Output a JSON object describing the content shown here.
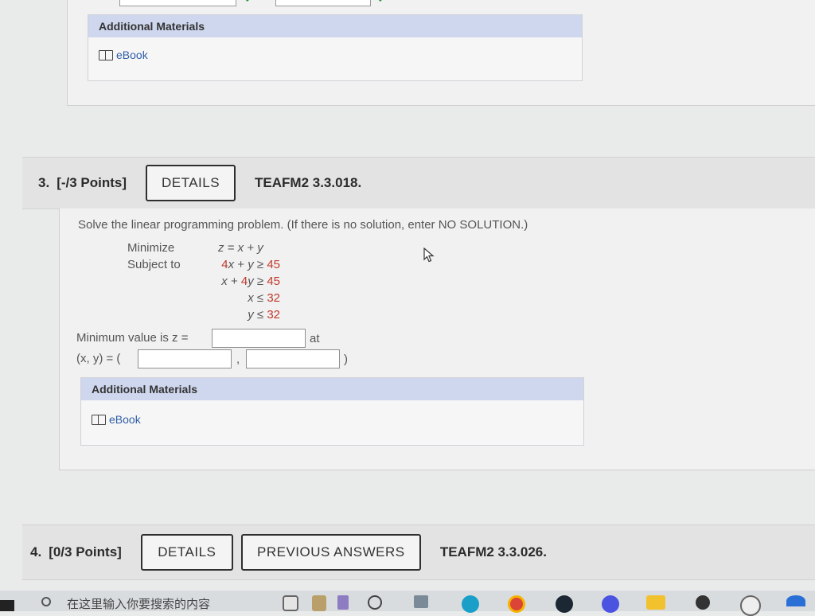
{
  "q2": {
    "additional_materials": "Additional Materials",
    "ebook": "eBook"
  },
  "q3": {
    "number": "3.",
    "points": "[-/3 Points]",
    "details_label": "DETAILS",
    "code": "TEAFM2 3.3.018.",
    "instructions": "Solve the linear programming problem. (If there is no solution, enter NO SOLUTION.)",
    "minimize_label": "Minimize",
    "objective": "z = x + y",
    "subject_to_label": "Subject to",
    "constraints": [
      "4x + y ≥ 45",
      "x + 4y ≥ 45",
      "x ≤ 32",
      "y ≤ 32"
    ],
    "min_value_label": "Minimum value is z =",
    "at_label": "at",
    "xy_label": "(x, y) = (",
    "comma": ",",
    "close_paren": ")",
    "min_value": "",
    "x_value": "",
    "y_value": "",
    "additional_materials": "Additional Materials",
    "ebook": "eBook"
  },
  "q4": {
    "number": "4.",
    "points": "[0/3 Points]",
    "details_label": "DETAILS",
    "previous_answers_label": "PREVIOUS ANSWERS",
    "code": "TEAFM2 3.3.026."
  },
  "taskbar": {
    "search_placeholder": "在这里输入你要搜索的内容"
  },
  "colors": {
    "accent_header": "#cfd7ee",
    "link": "#2f5ea6",
    "math_number": "#c0392b",
    "check": "#2e9e3c"
  }
}
